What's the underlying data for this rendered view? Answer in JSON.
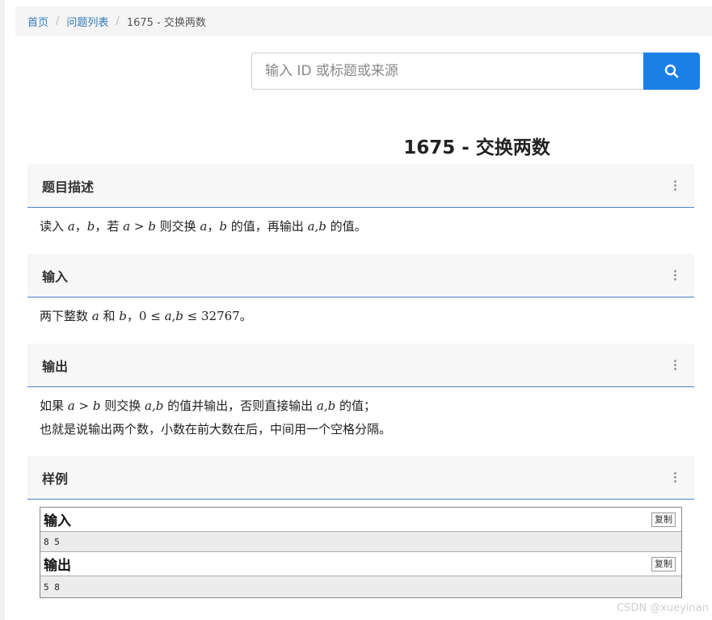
{
  "breadcrumb": {
    "home": "首页",
    "problem_list": "问题列表",
    "current": "1675 - 交换两数"
  },
  "search": {
    "placeholder": "输入 ID 或标题或来源",
    "value": ""
  },
  "problem": {
    "title": "1675 - 交换两数"
  },
  "sections": {
    "description": {
      "heading": "题目描述",
      "t1": "读入 ",
      "m1": "a",
      "t2": "，",
      "m2": "b",
      "t3": "，若 ",
      "m3": "a",
      "o1": " > ",
      "m4": "b",
      "t4": " 则交换 ",
      "m5": "a",
      "t5": "，",
      "m6": "b",
      "t6": " 的值，再输出 ",
      "m7": "a,b",
      "t7": " 的值。"
    },
    "input": {
      "heading": "输入",
      "t1": "两下整数 ",
      "m1": "a",
      "t2": " 和 ",
      "m2": "b",
      "t3": "，",
      "n1": "0 ≤ ",
      "m3": "a,b",
      "n2": " ≤ 32767",
      "t4": "。"
    },
    "output": {
      "heading": "输出",
      "t1": "如果 ",
      "m1": "a",
      "o1": " > ",
      "m2": "b",
      "t2": " 则交换 ",
      "m3": "a,b",
      "t3": " 的值并输出，否则直接输出 ",
      "m4": "a,b",
      "t4": " 的值；",
      "line2": "也就是说输出两个数，小数在前大数在后，中间用一个空格分隔。"
    },
    "sample": {
      "heading": "样例",
      "input_label": "输入",
      "input_data": "8 5",
      "output_label": "输出",
      "output_data": "5 8",
      "copy_label": "复制"
    }
  },
  "watermark": "CSDN @xueyinan",
  "colors": {
    "accent": "#1a7fe6",
    "link": "#337ab7",
    "section_border": "#4e80c2"
  }
}
